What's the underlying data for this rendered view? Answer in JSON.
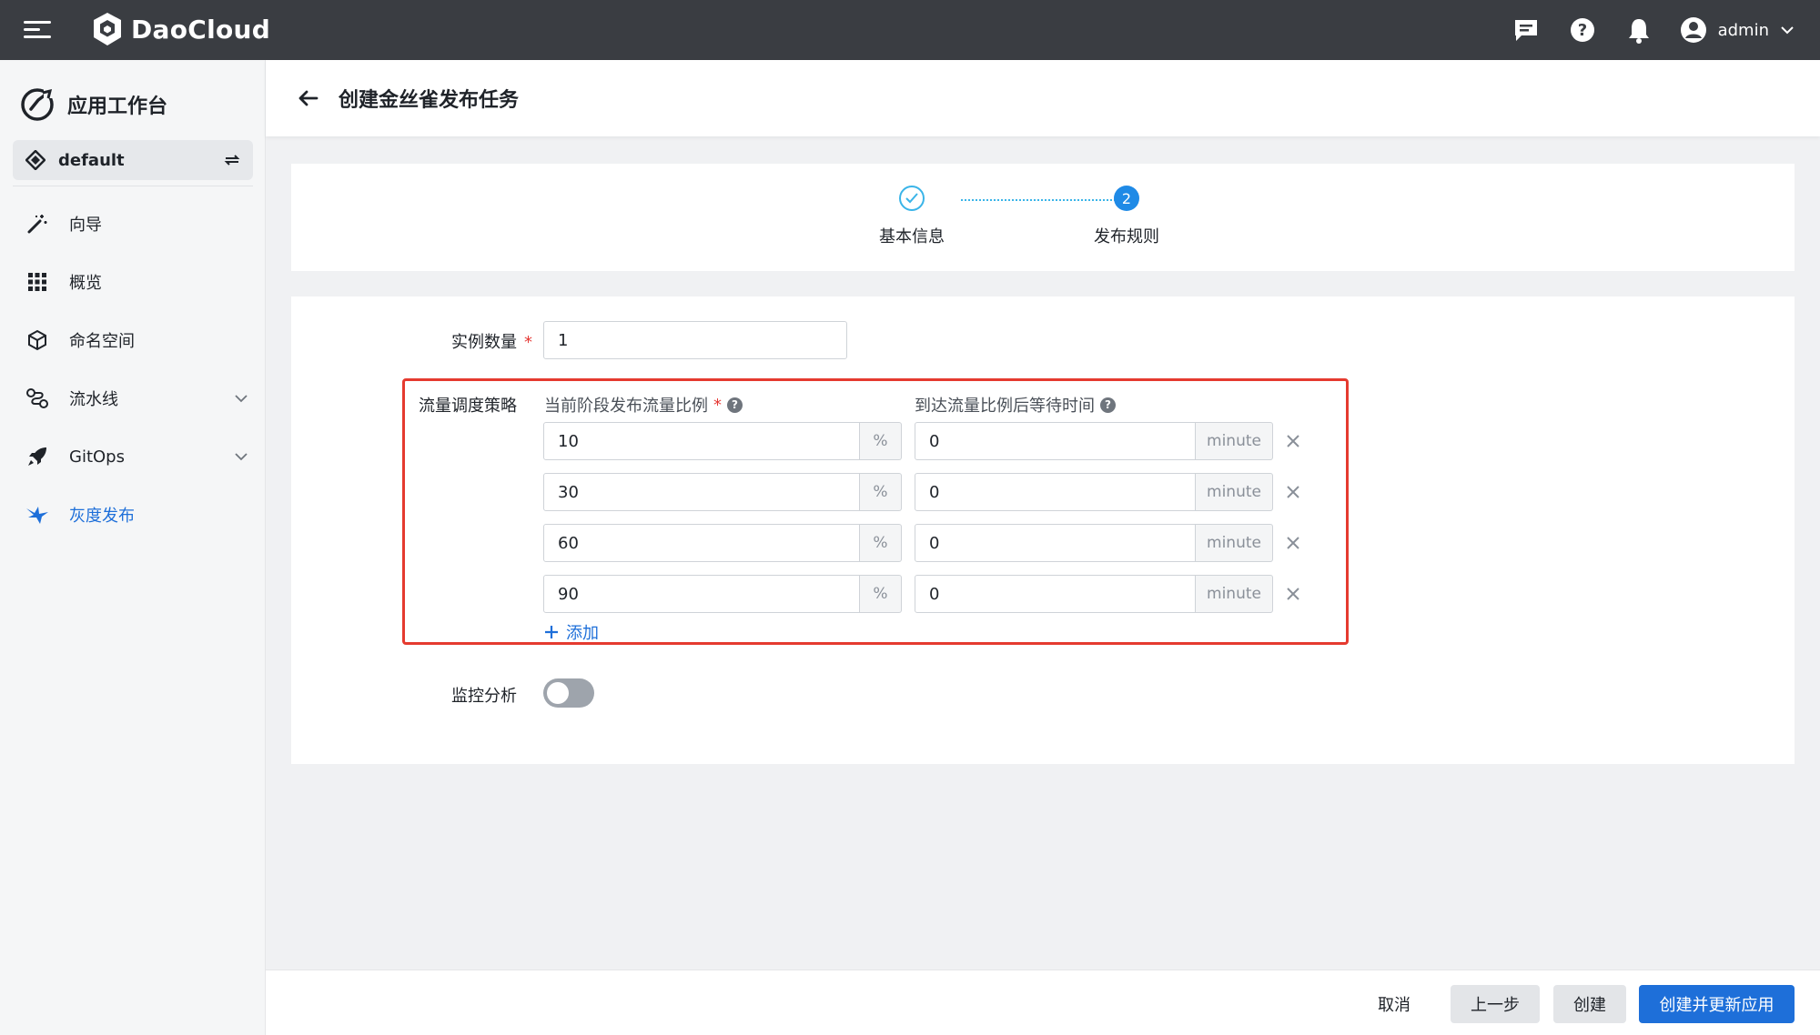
{
  "topbar": {
    "brand": "DaoCloud",
    "user": "admin"
  },
  "sidebar": {
    "workspace_title": "应用工作台",
    "namespace": "default",
    "items": [
      {
        "label": "向导",
        "icon": "wand-icon"
      },
      {
        "label": "概览",
        "icon": "grid-icon"
      },
      {
        "label": "命名空间",
        "icon": "cube-icon"
      },
      {
        "label": "流水线",
        "icon": "pipeline-icon"
      },
      {
        "label": "GitOps",
        "icon": "rocket-icon"
      },
      {
        "label": "灰度发布",
        "icon": "bird-icon"
      }
    ]
  },
  "header": {
    "title": "创建金丝雀发布任务"
  },
  "steps": [
    {
      "label": "基本信息",
      "state": "done"
    },
    {
      "label": "发布规则",
      "state": "current",
      "number": "2"
    }
  ],
  "form": {
    "instance_label": "实例数量",
    "instance_value": "1",
    "strategy_label": "流量调度策略",
    "ratio_header": "当前阶段发布流量比例",
    "wait_header": "到达流量比例后等待时间",
    "percent_unit": "%",
    "minute_unit": "minute",
    "rows": [
      {
        "ratio": "10",
        "wait": "0"
      },
      {
        "ratio": "30",
        "wait": "0"
      },
      {
        "ratio": "60",
        "wait": "0"
      },
      {
        "ratio": "90",
        "wait": "0"
      }
    ],
    "add_label": "添加",
    "monitor_label": "监控分析",
    "monitor_enabled": false
  },
  "footer": {
    "cancel": "取消",
    "prev": "上一步",
    "create": "创建",
    "create_update": "创建并更新应用"
  },
  "colors": {
    "accent": "#1e6fd9",
    "highlight_border": "#e53a2f",
    "topbar": "#3a3d42"
  }
}
